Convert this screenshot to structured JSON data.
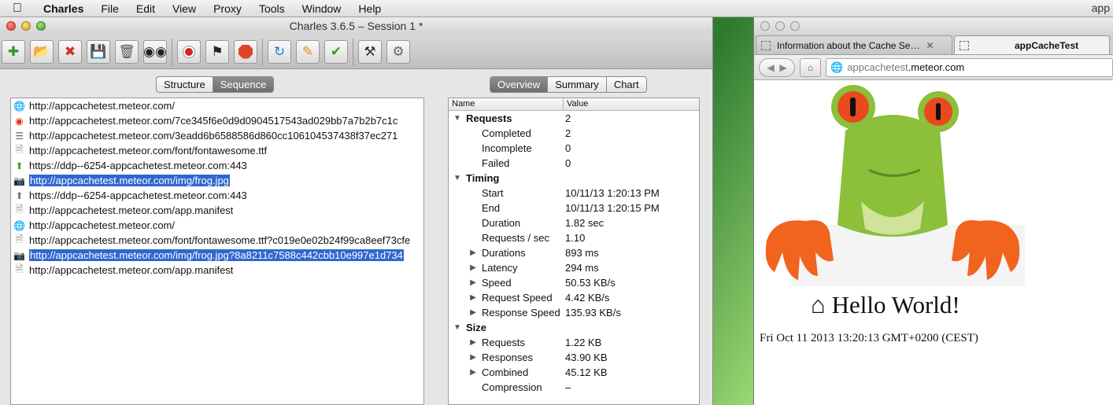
{
  "menubar": {
    "app": "Charles",
    "items": [
      "File",
      "Edit",
      "View",
      "Proxy",
      "Tools",
      "Window",
      "Help"
    ],
    "right_partial": "app"
  },
  "charles": {
    "title": "Charles 3.6.5 – Session 1 *",
    "toolbar_icons": [
      "new-session-icon",
      "open-session-icon",
      "close-session-icon",
      "save-session-icon",
      "clear-icon",
      "find-icon",
      "record-icon",
      "throttle-icon",
      "stop-icon",
      "repeat-icon",
      "edit-icon",
      "validate-icon",
      "tools-icon",
      "settings-icon"
    ],
    "view_tabs": [
      "Structure",
      "Sequence"
    ],
    "view_active": "Sequence",
    "info_tabs": [
      "Overview",
      "Summary",
      "Chart"
    ],
    "info_active": "Overview",
    "requests": [
      {
        "icon": "globe",
        "url": "http://appcachetest.meteor.com/"
      },
      {
        "icon": "chrome",
        "url": "http://appcachetest.meteor.com/7ce345f6e0d9d0904517543ad029bb7a7b2b7c1c"
      },
      {
        "icon": "script",
        "url": "http://appcachetest.meteor.com/3eadd6b6588586d860cc106104537438f37ec271"
      },
      {
        "icon": "doc",
        "url": "http://appcachetest.meteor.com/font/fontawesome.ttf"
      },
      {
        "icon": "arrow",
        "url": "https://ddp--6254-appcachetest.meteor.com:443"
      },
      {
        "icon": "image",
        "url": "http://appcachetest.meteor.com/img/frog.jpg",
        "selected": true
      },
      {
        "icon": "arrow-doc",
        "url": "https://ddp--6254-appcachetest.meteor.com:443"
      },
      {
        "icon": "doc",
        "url": "http://appcachetest.meteor.com/app.manifest"
      },
      {
        "icon": "globe",
        "url": "http://appcachetest.meteor.com/"
      },
      {
        "icon": "doc",
        "url": "http://appcachetest.meteor.com/font/fontawesome.ttf?c019e0e02b24f99ca8eef73cfe"
      },
      {
        "icon": "image",
        "url": "http://appcachetest.meteor.com/img/frog.jpg?8a8211c7588c442cbb10e997e1d734",
        "selected": true
      },
      {
        "icon": "doc",
        "url": "http://appcachetest.meteor.com/app.manifest"
      }
    ],
    "columns": [
      "Name",
      "Value"
    ],
    "properties": [
      {
        "name": "Requests",
        "value": "2",
        "level": 0,
        "group": true,
        "tri": "▼"
      },
      {
        "name": "Completed",
        "value": "2",
        "level": 1
      },
      {
        "name": "Incomplete",
        "value": "0",
        "level": 1
      },
      {
        "name": "Failed",
        "value": "0",
        "level": 1
      },
      {
        "name": "Timing",
        "value": "",
        "level": 0,
        "group": true,
        "tri": "▼"
      },
      {
        "name": "Start",
        "value": "10/11/13 1:20:13 PM",
        "level": 1
      },
      {
        "name": "End",
        "value": "10/11/13 1:20:15 PM",
        "level": 1
      },
      {
        "name": "Duration",
        "value": "1.82 sec",
        "level": 1
      },
      {
        "name": "Requests / sec",
        "value": "1.10",
        "level": 1
      },
      {
        "name": "Durations",
        "value": "893 ms",
        "level": 1,
        "tri": "▶"
      },
      {
        "name": "Latency",
        "value": "294 ms",
        "level": 1,
        "tri": "▶"
      },
      {
        "name": "Speed",
        "value": "50.53 KB/s",
        "level": 1,
        "tri": "▶"
      },
      {
        "name": "Request Speed",
        "value": "4.42 KB/s",
        "level": 1,
        "tri": "▶"
      },
      {
        "name": "Response Speed",
        "value": "135.93 KB/s",
        "level": 1,
        "tri": "▶"
      },
      {
        "name": "Size",
        "value": "",
        "level": 0,
        "group": true,
        "tri": "▼"
      },
      {
        "name": "Requests",
        "value": "1.22 KB",
        "level": 1,
        "tri": "▶"
      },
      {
        "name": "Responses",
        "value": "43.90 KB",
        "level": 1,
        "tri": "▶"
      },
      {
        "name": "Combined",
        "value": "45.12 KB",
        "level": 1,
        "tri": "▶"
      },
      {
        "name": "Compression",
        "value": "–",
        "level": 1
      }
    ]
  },
  "browser": {
    "tabs": [
      {
        "title": "Information about the Cache Se…",
        "active": false,
        "close": "✕"
      },
      {
        "title": "appCacheTest",
        "active": true
      }
    ],
    "url_host": "appcachetest",
    "url_domain": ".meteor.com",
    "heading": "Hello World!",
    "date": "Fri Oct 11 2013 13:20:13 GMT+0200 (CEST)"
  },
  "colors": {
    "selection": "#2f67d0",
    "frog_eye": "#e8491d",
    "frog_body": "#8cbf3a"
  }
}
